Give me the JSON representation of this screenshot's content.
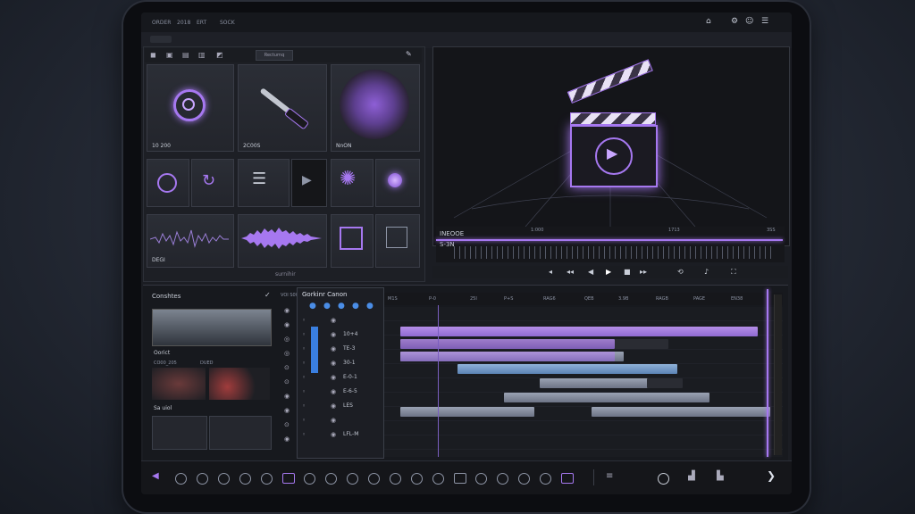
{
  "topbar": {
    "items": [
      "ORDER",
      "2018",
      "ERT",
      "SOCK"
    ],
    "icons": [
      "logo-icon",
      "settings-icon",
      "user-icon",
      "menu-icon"
    ]
  },
  "library": {
    "header_tab": "Recturnq",
    "tiles": [
      {
        "label": "10 200",
        "icon": "target-icon"
      },
      {
        "label": "2C00S",
        "icon": "wrench-icon"
      },
      {
        "label": "NnON",
        "icon": "disc-icon"
      },
      {
        "label": "",
        "icon": "clock-icon"
      },
      {
        "label": "",
        "icon": "swirl-icon"
      },
      {
        "label": "",
        "icon": "list-icon"
      },
      {
        "label": "",
        "icon": "play-icon"
      },
      {
        "label": "",
        "icon": "burst-icon"
      },
      {
        "label": "",
        "icon": "orb-icon"
      },
      {
        "label": "DEGI",
        "icon": "waveform-icon"
      },
      {
        "label": "",
        "icon": "waveform-icon"
      },
      {
        "label": "",
        "icon": "frame-icon"
      },
      {
        "label": "",
        "icon": "grid-icon"
      }
    ],
    "footer": "surnihir"
  },
  "viewer": {
    "overlay": "INEOOE",
    "timecode_left": "S-3N",
    "tick_1": "1:000",
    "tick_2": "1713",
    "tick_3": "3SS"
  },
  "sidebar_panel": {
    "title": "Conshtes",
    "clip_1_label": "Oorict",
    "clip_1_sub": "CO00_205",
    "clip_1_sub2": "DUED",
    "clip_2_label": "Sa uiol"
  },
  "timeline": {
    "tracklist_title": "Gorkinr Canon",
    "col_label": "VOI S0W",
    "tracks": [
      "",
      "10+4",
      "TE-3",
      "30-1",
      "E-0-1",
      "E-6-5",
      "LES",
      "LFL-M"
    ],
    "ruler": [
      "M1S",
      "P-0",
      "25I",
      "P+S",
      "RAG6",
      "QEB",
      "3.9B",
      "RAGB",
      "PAGE",
      "EN38"
    ]
  },
  "colors": {
    "accent": "#a678f0",
    "background": "#1b1d23",
    "clip_purple": "#b58ee8",
    "clip_blue": "#8fb1d8"
  }
}
